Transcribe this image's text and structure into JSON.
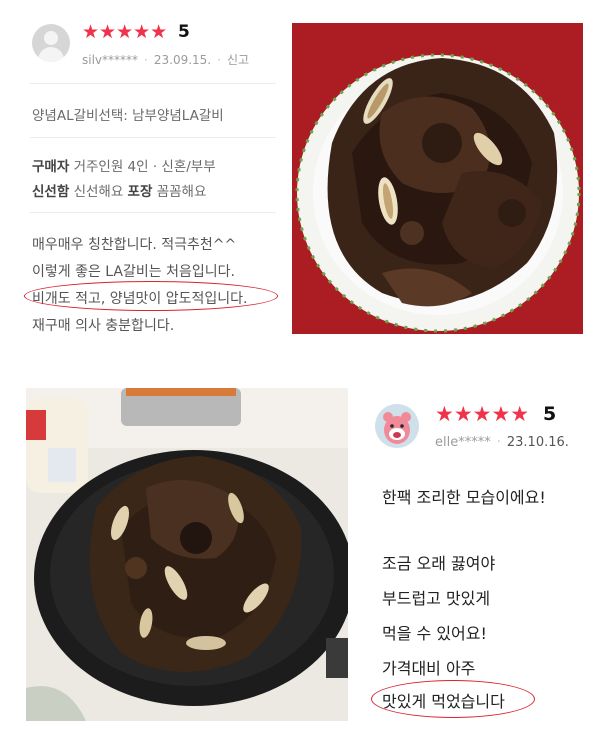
{
  "review1": {
    "rating": "5",
    "stars": "★★★★★",
    "username": "silv******",
    "date": "23.09.15.",
    "report": "신고",
    "option": "양념AL갈비선택: 남부양념LA갈비",
    "buyer_label": "구매자",
    "buyer_info": "거주인원 4인 · 신혼/부부",
    "freshness_label": "신선함",
    "freshness_value": "신선해요",
    "packaging_label": "포장",
    "packaging_value": "꼼꼼해요",
    "lines": [
      "매우매우 칭찬합니다. 적극추천^^",
      "이렇게 좋은 LA갈비는 처음입니다.",
      "비개도 적고, 양념맛이 압도적입니다.",
      "재구매 의사 충분합니다."
    ]
  },
  "review2": {
    "rating": "5",
    "stars": "★★★★★",
    "username": "elle*****",
    "date": "23.10.16.",
    "lines": [
      "한팩 조리한 모습이에요!",
      "조금 오래 끓여야",
      "부드럽고 맛있게",
      "먹을 수 있어요!",
      "가격대비 아주",
      "맛있게 먹었습니다"
    ]
  },
  "colors": {
    "star": "#f0324a",
    "highlight_circle": "#d9232d",
    "meat": "#3a2418",
    "plate_rim": "#6aa64a"
  }
}
